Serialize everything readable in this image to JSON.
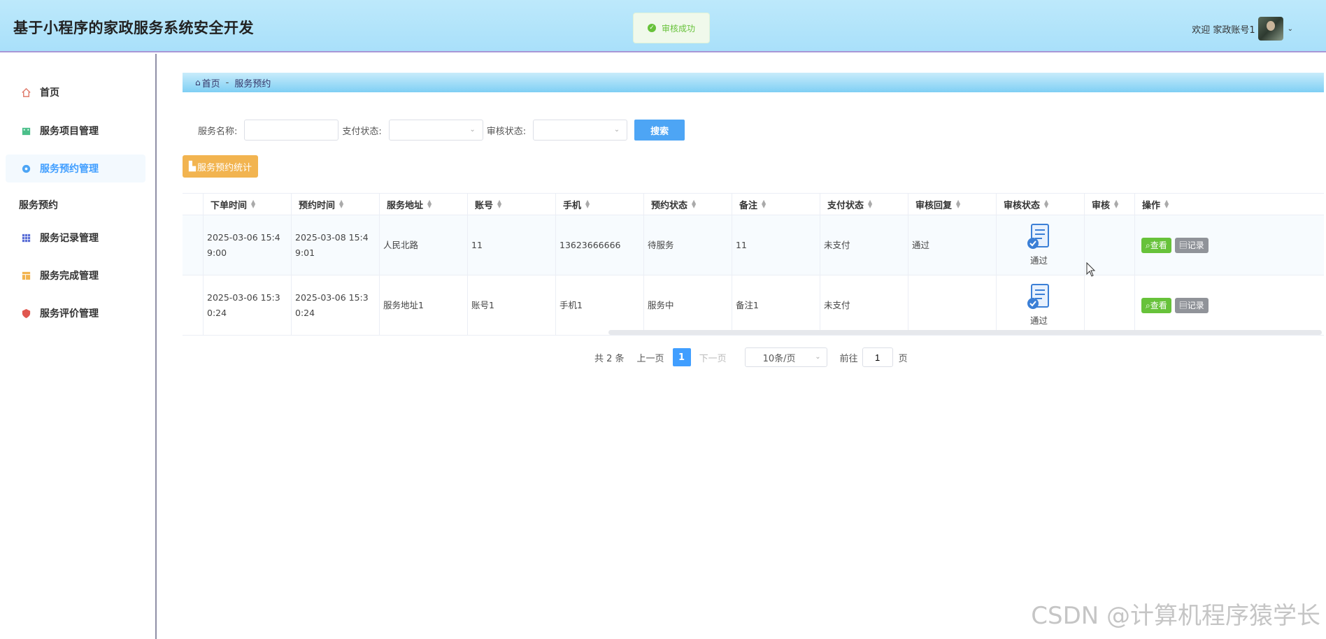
{
  "header": {
    "app_title": "基于小程序的家政服务系统安全开发",
    "toast": "审核成功",
    "welcome": "欢迎 家政账号1"
  },
  "sidebar": {
    "items": [
      {
        "label": "首页",
        "icon": "home-icon"
      },
      {
        "label": "服务项目管理",
        "icon": "building-icon"
      },
      {
        "label": "服务预约管理",
        "icon": "dot-icon",
        "active": true
      },
      {
        "label": "服务记录管理",
        "icon": "grid-icon"
      },
      {
        "label": "服务完成管理",
        "icon": "table-icon"
      },
      {
        "label": "服务评价管理",
        "icon": "shield-icon"
      }
    ],
    "sub_label": "服务预约"
  },
  "breadcrumb": {
    "home": "首页",
    "current": "服务预约"
  },
  "search": {
    "name_label": "服务名称:",
    "name_value": "",
    "pay_label": "支付状态:",
    "audit_label": "审核状态:",
    "button": "搜索"
  },
  "stats_button": "服务预约统计",
  "table": {
    "columns": [
      "下单时间",
      "预约时间",
      "服务地址",
      "账号",
      "手机",
      "预约状态",
      "备注",
      "支付状态",
      "审核回复",
      "审核状态",
      "审核",
      "操作"
    ],
    "rows": [
      {
        "order_time": "2025-03-06 15:49:00",
        "appoint_time": "2025-03-08 15:49:01",
        "address": "人民北路",
        "account": "11",
        "phone": "13623666666",
        "status": "待服务",
        "remark": "11",
        "pay": "未支付",
        "reply": "通过",
        "audit_status": "通过",
        "audit": ""
      },
      {
        "order_time": "2025-03-06 15:30:24",
        "appoint_time": "2025-03-06 15:30:24",
        "address": "服务地址1",
        "account": "账号1",
        "phone": "手机1",
        "status": "服务中",
        "remark": "备注1",
        "pay": "未支付",
        "reply": "",
        "audit_status": "通过",
        "audit": ""
      }
    ],
    "view_btn": "查看",
    "log_btn": "记录"
  },
  "pager": {
    "total": "共 2 条",
    "prev": "上一页",
    "page": "1",
    "next": "下一页",
    "size": "10条/页",
    "goto": "前往",
    "goto_value": "1",
    "page_suffix": "页"
  },
  "watermark": "CSDN @计算机程序猿学长",
  "colors": {
    "primary": "#409eff",
    "success": "#67c23a",
    "warning": "#f2b450",
    "header": "#a9e0fa"
  }
}
